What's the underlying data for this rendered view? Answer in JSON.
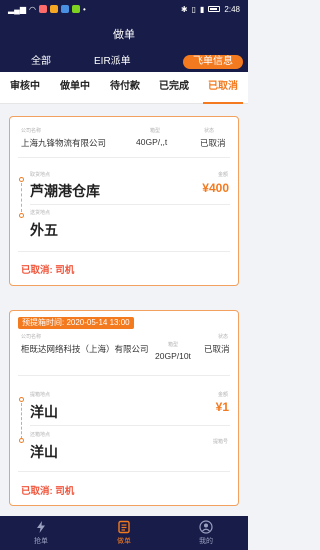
{
  "status_bar": {
    "time": "2:48",
    "colors": [
      "#ff6b6b",
      "#f5a623",
      "#4a90e2",
      "#7ed321"
    ]
  },
  "header": {
    "title": "做单",
    "tabs": [
      {
        "label": "全部"
      },
      {
        "label": "EIR派单"
      },
      {
        "label": "飞单信息"
      }
    ]
  },
  "status_tabs": [
    {
      "label": "审核中"
    },
    {
      "label": "做单中"
    },
    {
      "label": "待付款"
    },
    {
      "label": "已完成"
    },
    {
      "label": "已取消"
    }
  ],
  "orders": [
    {
      "badge": "",
      "company_label": "公司名称",
      "company": "上海九锋物流有限公司",
      "box_label": "箱型",
      "box": "40GP/,,t",
      "status_label": "状态",
      "status": "已取消",
      "pickup_label": "取货地点",
      "pickup": "芦潮港仓库",
      "amount_label": "金额",
      "amount": "¥400",
      "return_label": "送货地点",
      "return": "外五",
      "cancel_text": "已取消: 司机"
    },
    {
      "badge": "预提箱时间: 2020-05-14 13:00",
      "company_label": "公司名称",
      "company": "柜既达网络科技（上海）有限公司",
      "box_label": "箱型",
      "box": "20GP/10t",
      "status_label": "状态",
      "status": "已取消",
      "pickup_label": "提箱地点",
      "pickup": "洋山",
      "amount_label": "金额",
      "amount": "¥1",
      "return_label": "还箱地点",
      "return_extra_label": "提箱号",
      "return": "洋山",
      "cancel_text": "已取消: 司机"
    }
  ],
  "bottom_nav": [
    {
      "label": "抢单",
      "icon": "lightning-icon"
    },
    {
      "label": "做单",
      "icon": "document-icon"
    },
    {
      "label": "我的",
      "icon": "user-icon"
    }
  ],
  "colors": {
    "navy": "#171c48",
    "accent": "#f37a1f",
    "cancel": "#f0553b"
  }
}
